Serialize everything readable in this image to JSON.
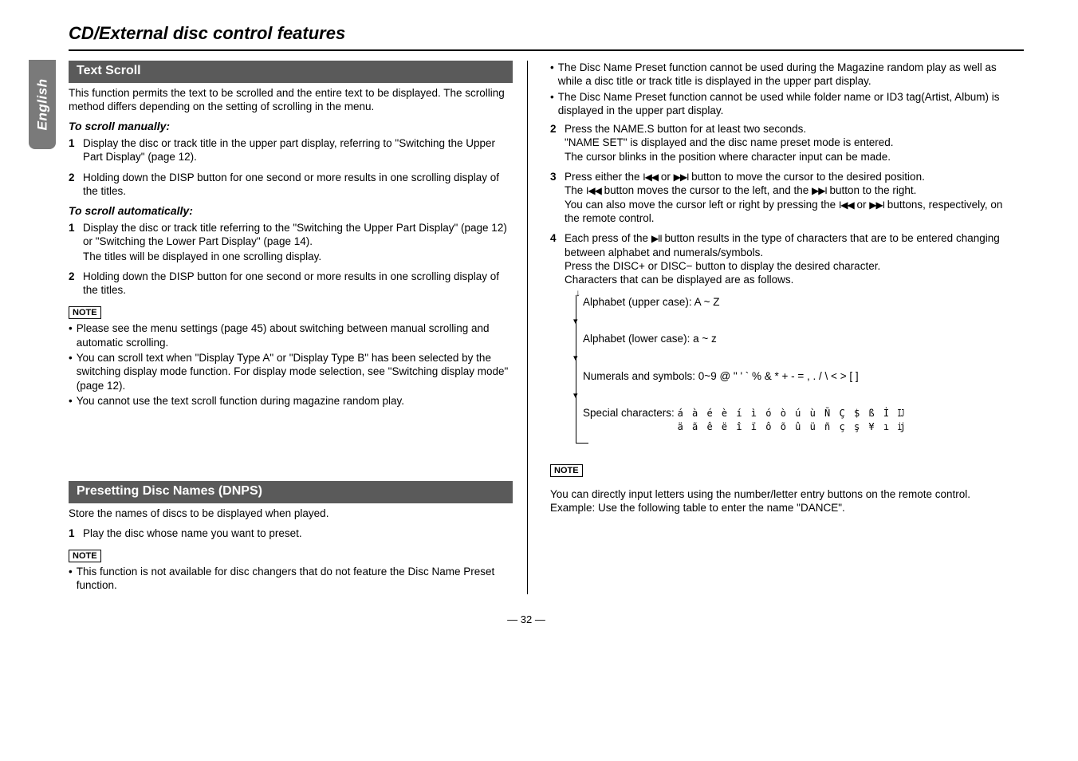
{
  "side_tab": "English",
  "page_title": "CD/External disc control features",
  "pagenum": "— 32 —",
  "left": {
    "text_scroll": {
      "head": "Text Scroll",
      "intro": "This function permits the text to be scrolled and the entire text to be displayed. The scrolling method differs depending on the setting of scrolling in the menu.",
      "manual_head": "To scroll manually:",
      "manual_1": "Display the disc or track title in the upper part display, referring to \"Switching the Upper Part Display\" (page 12).",
      "manual_2": "Holding down the DISP button for one second or more results in one scrolling display of the titles.",
      "auto_head": "To scroll automatically:",
      "auto_1a": "Display the disc or track title referring to the \"Switching the Upper Part Display\" (page 12) or \"Switching the Lower Part Display\" (page 14).",
      "auto_1b": "The titles will be displayed in one scrolling display.",
      "auto_2": "Holding down the DISP button for one second or more results in one scrolling display of the titles.",
      "note_label": "NOTE",
      "note_b1": "Please see the menu settings (page 45) about switching between manual scrolling and automatic scrolling.",
      "note_b2": "You can scroll text when \"Display Type A\" or \"Display Type B\" has been selected by the switching display mode function. For display mode selection, see \"Switching display mode\" (page 12).",
      "note_b3": "You cannot use the text scroll function during magazine random play."
    },
    "dnps": {
      "head": "Presetting Disc Names (DNPS)",
      "intro": "Store the names of discs to be displayed when played.",
      "step1": "Play the disc whose name you want to preset.",
      "note_label": "NOTE",
      "note_b1": "This function is not available for disc changers that do not feature the Disc Name Preset function."
    }
  },
  "right": {
    "top_b1": "The Disc Name Preset function cannot be used during the Magazine random play as well as while a disc title or track title is displayed in the upper part display.",
    "top_b2": "The Disc Name Preset function cannot be used while folder name or ID3 tag(Artist, Album) is displayed in the upper part display.",
    "step2a": "Press the NAME.S button for at least two seconds.",
    "step2b": "\"NAME SET\" is displayed and the disc name preset mode is entered.",
    "step2c": "The cursor blinks in the position where character input can be made.",
    "step3a_pre": "Press either the ",
    "step3a_mid": " or ",
    "step3a_post": " button to move the cursor to the desired position.",
    "step3b_pre": "The ",
    "step3b_mid": " button moves the cursor to the left, and the ",
    "step3b_post": " button to the right.",
    "step3c_pre": "You can also move the cursor left or right by pressing the ",
    "step3c_mid": " or ",
    "step3c_post": " buttons, respectively, on the remote control.",
    "step4a_pre": "Each press of the ",
    "step4a_post": " button results in the type of characters that are to be entered changing between alphabet and numerals/symbols.",
    "step4b": "Press the DISC+ or DISC− button to display the desired character.",
    "step4c": "Characters that can be displayed are as follows.",
    "flow_upper": "Alphabet (upper case): A ~ Z",
    "flow_lower": "Alphabet (lower case): a ~ z",
    "flow_nums": "Numerals and symbols: 0~9 @ \" ' ` % & * + - = , . / \\ < > [ ]",
    "flow_spec_label": "Special characters: ",
    "flow_spec_line1": "á à é è í ì ó ò ú ù Ñ Ç $ ß İ Ĳ",
    "flow_spec_line2": "ä ã ê ë î ï ô õ û ü ñ ç ş ¥ ı ĳ",
    "note_label": "NOTE",
    "note_p1": "You can directly input letters using the number/letter entry buttons on the remote control.",
    "note_p2": "Example: Use the following table to enter the name \"DANCE\"."
  }
}
